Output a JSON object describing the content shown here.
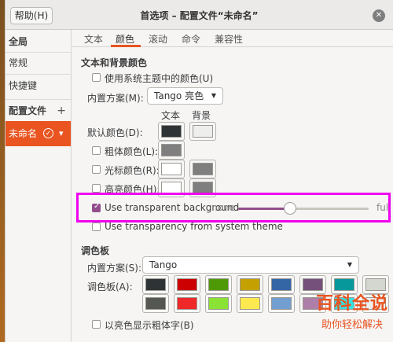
{
  "window": {
    "title": "首选项 – 配置文件“未命名”",
    "help_label": "帮助(H)",
    "close_symbol": "✕"
  },
  "sidebar": {
    "global_header": "全局",
    "general": "常规",
    "shortcuts": "快捷键",
    "profiles_header": "配置文件",
    "add_symbol": "+",
    "profile_name": "未命名",
    "default_symbol": "✓",
    "menu_symbol": "▾"
  },
  "tabs": [
    "文本",
    "颜色",
    "滚动",
    "命令",
    "兼容性"
  ],
  "active_tab_index": 1,
  "text_bg": {
    "section_title": "文本和背景颜色",
    "use_system_theme": "使用系统主题中的颜色(U)",
    "use_system_theme_checked": false,
    "builtin_scheme_label": "内置方案(M):",
    "builtin_scheme_value": "Tango 亮色",
    "col_text": "文本",
    "col_background": "背景",
    "rows": [
      {
        "label": "默认颜色(D):",
        "has_checkbox": false,
        "checked": false,
        "text_color": "#2e3436",
        "bg_color": "#eeeeec"
      },
      {
        "label": "粗体颜色(L):",
        "has_checkbox": true,
        "checked": false,
        "text_color": "#7f7f7f",
        "bg_color": null
      },
      {
        "label": "光标颜色(R):",
        "has_checkbox": true,
        "checked": false,
        "text_color": "#ffffff",
        "bg_color": "#7f7f7f"
      },
      {
        "label": "高亮颜色(H):",
        "has_checkbox": true,
        "checked": false,
        "text_color": "#ffffff",
        "bg_color": "#7f7f7f"
      }
    ],
    "transparent_bg": "Use transparent background",
    "transparent_bg_checked": true,
    "slider_min_label": "none",
    "slider_max_label": "full",
    "transparency_level": 0.4,
    "system_transparency": "Use transparency from system theme",
    "system_transparency_checked": false
  },
  "palette": {
    "section_title": "调色板",
    "builtin_scheme_label": "内置方案(S):",
    "builtin_scheme_value": "Tango",
    "palette_label": "调色板(A):",
    "row1": [
      "#2e3436",
      "#cc0000",
      "#4e9a06",
      "#c4a000",
      "#3465a4",
      "#75507b",
      "#06989a",
      "#d3d7cf"
    ],
    "row2": [
      "#555753",
      "#ef2929",
      "#8ae234",
      "#fce94f",
      "#729fcf",
      "#ad7fa8",
      "#34e2e2",
      "#eeeeec"
    ],
    "bright_bold": "以亮色显示粗体字(B)",
    "bright_bold_checked": false
  },
  "watermark": {
    "big": "百科全说",
    "small": "助你轻松解决"
  },
  "colors": {
    "accent": "#e95420",
    "check_accent": "#924d8b",
    "highlight_box": "#ee00ee"
  }
}
